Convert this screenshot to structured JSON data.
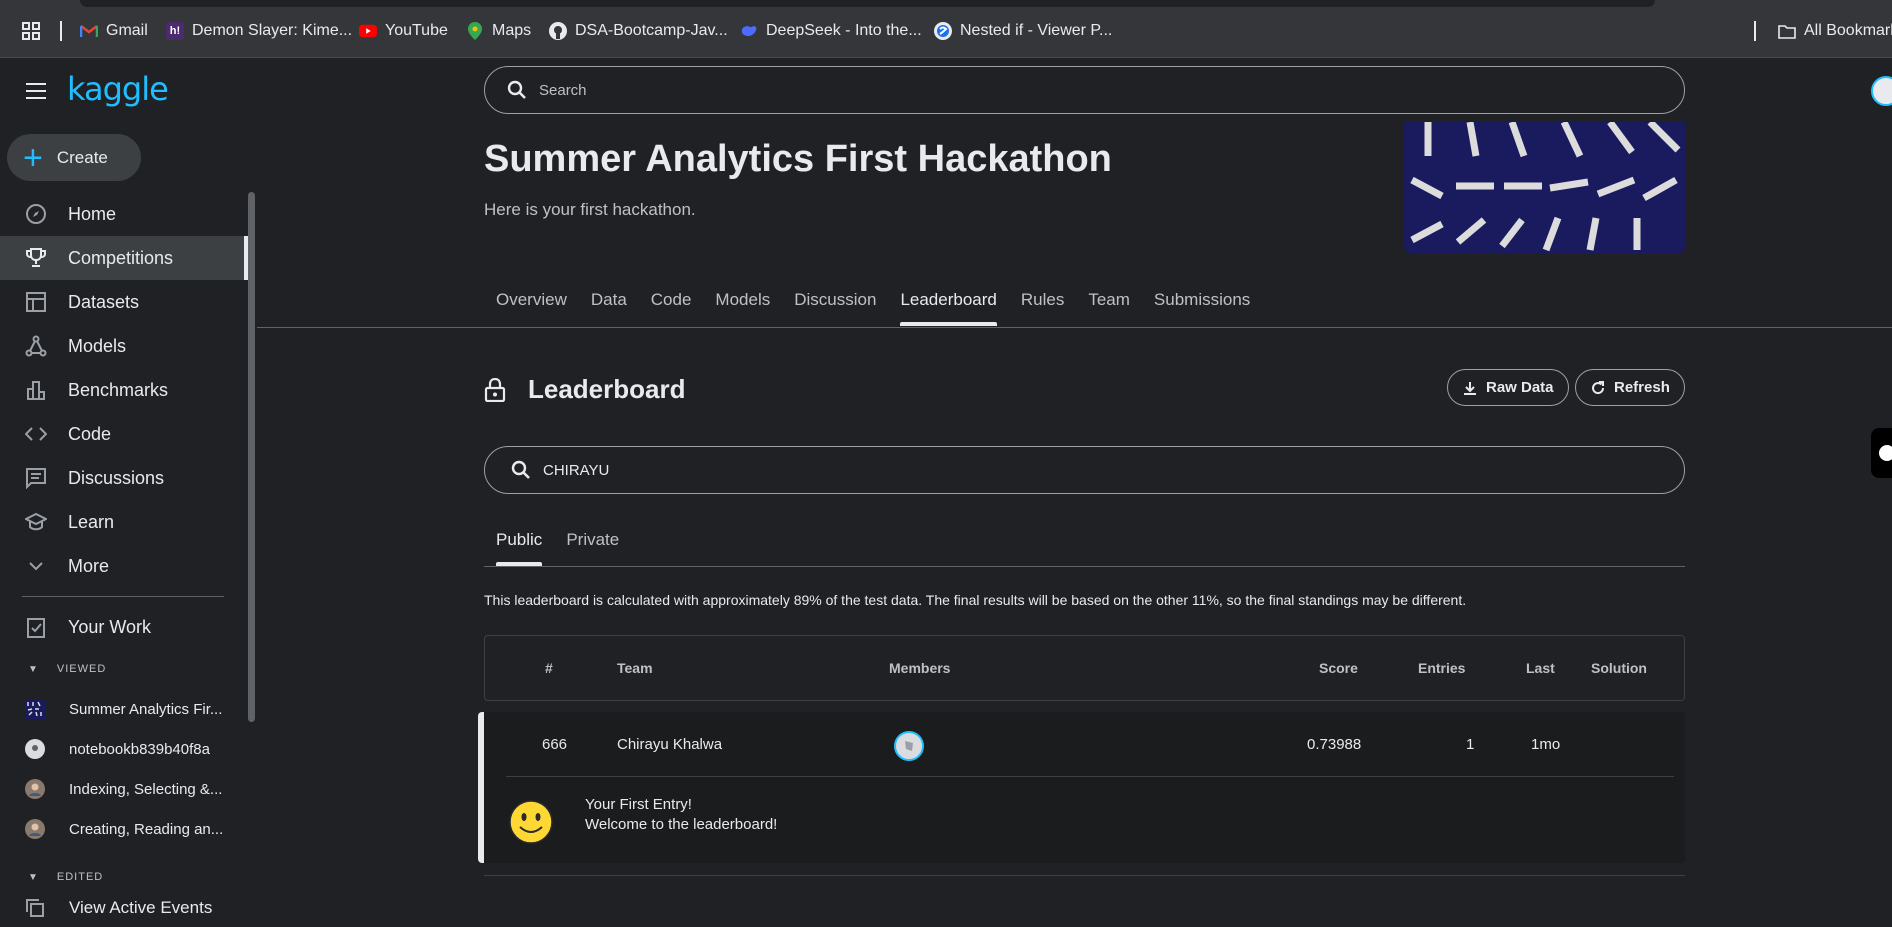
{
  "bookmarks": {
    "items": [
      {
        "label": "Gmail",
        "icon": "gmail-icon"
      },
      {
        "label": "Demon Slayer: Kime...",
        "icon": "anime-site-icon"
      },
      {
        "label": "YouTube",
        "icon": "youtube-icon"
      },
      {
        "label": "Maps",
        "icon": "maps-icon"
      },
      {
        "label": "DSA-Bootcamp-Jav...",
        "icon": "github-icon"
      },
      {
        "label": "DeepSeek - Into the...",
        "icon": "deepseek-icon"
      },
      {
        "label": "Nested if - Viewer P...",
        "icon": "scaler-icon"
      }
    ],
    "all_bookmarks": "All Bookmarks"
  },
  "sidebar": {
    "logo": "kaggle",
    "create": "Create",
    "items": [
      {
        "label": "Home",
        "icon": "compass-icon"
      },
      {
        "label": "Competitions",
        "icon": "trophy-icon"
      },
      {
        "label": "Datasets",
        "icon": "table-icon"
      },
      {
        "label": "Models",
        "icon": "models-icon"
      },
      {
        "label": "Benchmarks",
        "icon": "bar-chart-icon"
      },
      {
        "label": "Code",
        "icon": "code-icon"
      },
      {
        "label": "Discussions",
        "icon": "comment-icon"
      },
      {
        "label": "Learn",
        "icon": "school-icon"
      },
      {
        "label": "More",
        "icon": "chevron-down-icon"
      }
    ],
    "your_work": "Your Work",
    "viewed_label": "VIEWED",
    "viewed": [
      "Summer Analytics Fir...",
      "notebookb839b40f8a",
      "Indexing, Selecting &...",
      "Creating, Reading an..."
    ],
    "edited_label": "EDITED",
    "edited": [
      "View Active Events"
    ]
  },
  "search": {
    "placeholder": "Search"
  },
  "competition": {
    "title": "Summer Analytics First Hackathon",
    "subtitle": "Here is your first hackathon.",
    "tabs": [
      "Overview",
      "Data",
      "Code",
      "Models",
      "Discussion",
      "Leaderboard",
      "Rules",
      "Team",
      "Submissions"
    ],
    "active_tab": "Leaderboard"
  },
  "leaderboard": {
    "title": "Leaderboard",
    "raw_data": "Raw Data",
    "refresh": "Refresh",
    "search_value": "CHIRAYU",
    "subtabs": [
      "Public",
      "Private"
    ],
    "note": "This leaderboard is calculated with approximately 89% of the test data. The final results will be based on the other 11%, so the final standings may be different.",
    "columns": {
      "rank": "#",
      "team": "Team",
      "members": "Members",
      "score": "Score",
      "entries": "Entries",
      "last": "Last",
      "solution": "Solution"
    },
    "row": {
      "rank": "666",
      "team": "Chirayu Khalwa",
      "score": "0.73988",
      "entries": "1",
      "last": "1mo"
    },
    "first_entry_title": "Your First Entry!",
    "first_entry_sub": "Welcome to the leaderboard!"
  },
  "colors": {
    "accent": "#20beff",
    "background": "#202124",
    "banner": "#1a1a5e"
  }
}
